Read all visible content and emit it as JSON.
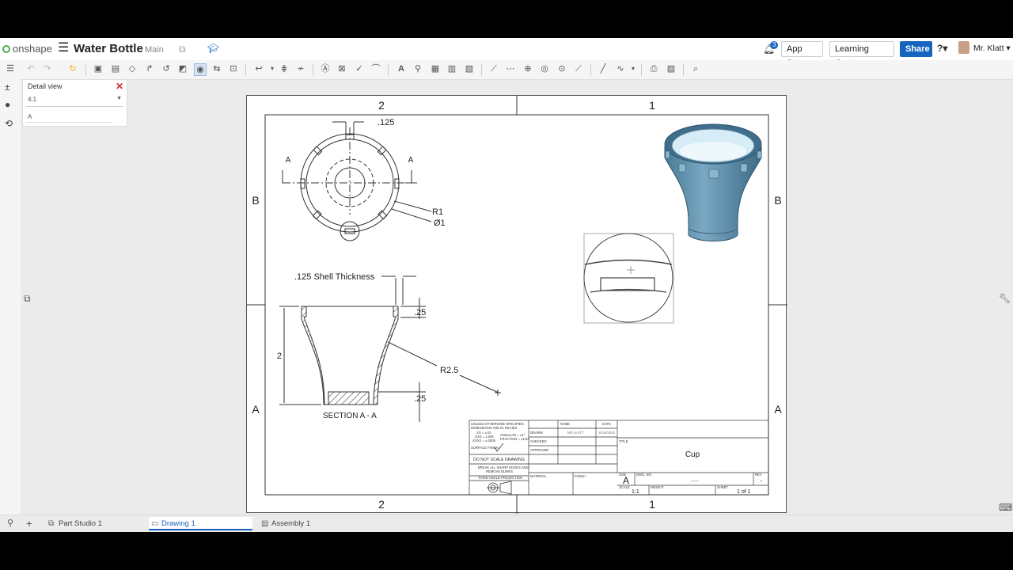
{
  "header": {
    "brand": "onshape",
    "doc_title": "Water Bottle",
    "branch": "Main",
    "notif_count": "3",
    "app_store": "App Store",
    "learning_center": "Learning Center",
    "share": "Share",
    "help": "?",
    "user": "Mr. Klatt"
  },
  "panel": {
    "title": "Detail view",
    "scale": "4:1",
    "label": "A"
  },
  "drawing": {
    "zone_top_left": "2",
    "zone_top_right": "1",
    "zone_bottom_left": "2",
    "zone_bottom_right": "1",
    "zone_left_top": "B",
    "zone_left_bottom": "A",
    "zone_right_top": "B",
    "zone_right_bottom": "A",
    "dim_slot": ".125",
    "cut_a1": "A",
    "cut_a2": "A",
    "dim_r1": "R1",
    "dim_dia": "Ø1",
    "shell_note": ".125 Shell Thickness",
    "dim_top": ".25",
    "dim_height": "2",
    "dim_bottom": ".25",
    "dim_radius": "R2.5",
    "section_label": "SECTION A - A",
    "title_block": {
      "unless": "UNLESS OTHERWISE SPECIFIED,",
      "dims_in": "DIMENSIONS ARE IN INCHES",
      "tol1": ".XX = ±.01",
      "tol2": ".XXX = ±.005",
      "tol3": ".XXXX = ±.0005",
      "angle": "ANGULAR = ±1°",
      "fraction": "FRACTION = ±1/32",
      "surface": "SURFACE FINISH",
      "no_scale": "DO NOT SCALE DRAWING",
      "break1": "BREAK ALL SHARP EDGES AND",
      "break2": "REMOVE BURRS",
      "projection": "THIRD ANGLE PROJECTION",
      "name_h": "NAME",
      "date_h": "DATE",
      "drawn": "DRAWN",
      "drawn_name": "MR.KLATT",
      "drawn_date": "10/15/2020",
      "checked": "CHECKED",
      "approved": "APPROVED",
      "material": "MATERIAL",
      "finish": "FINISH",
      "title_h": "TITLE",
      "title": "Cup",
      "size_h": "SIZE",
      "size": "A",
      "dwg_h": "DWG. NO.",
      "dwg": "----",
      "rev_h": "REV",
      "rev": "-",
      "scale_h": "SCALE",
      "scale": "1:1",
      "weight_h": "WEIGHT",
      "sheet_h": "SHEET",
      "sheet": "1 of 1"
    }
  },
  "tabs": [
    {
      "label": "Part Studio 1"
    },
    {
      "label": "Drawing 1"
    },
    {
      "label": "Assembly 1"
    }
  ],
  "colors": {
    "accent": "#1565c0",
    "cup_body": "#5b8ba8",
    "cup_inner": "#d6ecf6"
  }
}
